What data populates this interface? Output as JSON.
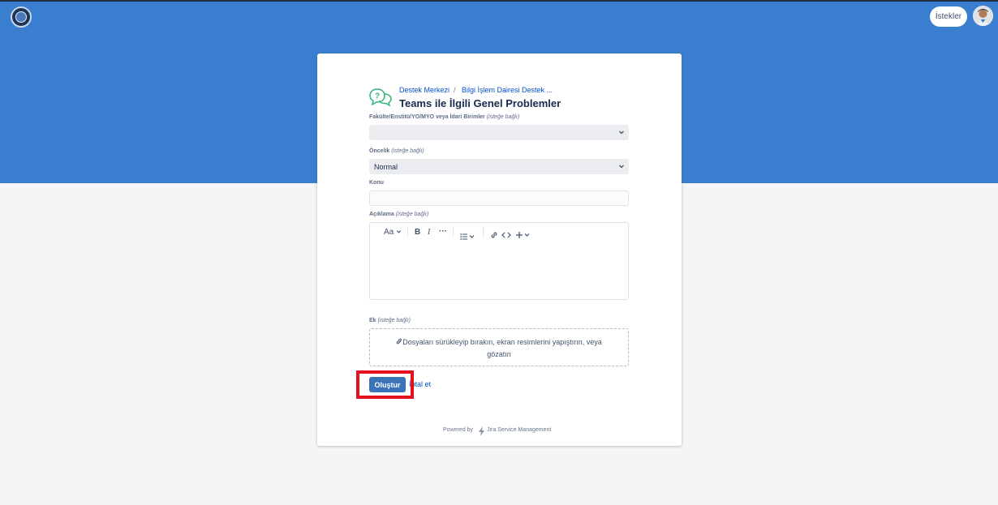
{
  "header": {
    "logo_icon": "university-logo-icon",
    "requests_label": "İstekler",
    "avatar_icon": "user-avatar-icon"
  },
  "colors": {
    "banner": "#3a7fcf",
    "primary_button": "#3b73b9",
    "link": "#0052cc",
    "highlight": "#e3101e"
  },
  "breadcrumb": {
    "items": [
      "Destek Merkezi",
      "Bilgi İşlem Dairesi Destek ..."
    ],
    "separator": "/"
  },
  "form": {
    "icon": "help-bubble-icon",
    "title": "Teams ile İlgili Genel Problemler",
    "faculty": {
      "label": "Fakülte/Enstitü/YO/MYO veya İdari Birimler",
      "optional": "(isteğe bağlı)",
      "value": ""
    },
    "priority": {
      "label": "Öncelik",
      "optional": "(isteğe bağlı)",
      "value": "Normal"
    },
    "subject": {
      "label": "Konu",
      "value": ""
    },
    "description": {
      "label": "Açıklama",
      "optional": "(isteğe bağlı)",
      "toolbar": {
        "text_style": "Aa",
        "bold": "B",
        "italic": "I",
        "more": "···"
      }
    },
    "attachment": {
      "label": "Ek",
      "optional": "(isteğe bağlı)",
      "drop_text": "Dosyaları sürükleyip bırakın, ekran resimlerini yapıştırın, veya gözatın"
    },
    "create_label": "Oluştur",
    "cancel_label": "İptal et"
  },
  "footer": {
    "powered_by": "Powered by",
    "product": "Jira Service Management"
  }
}
